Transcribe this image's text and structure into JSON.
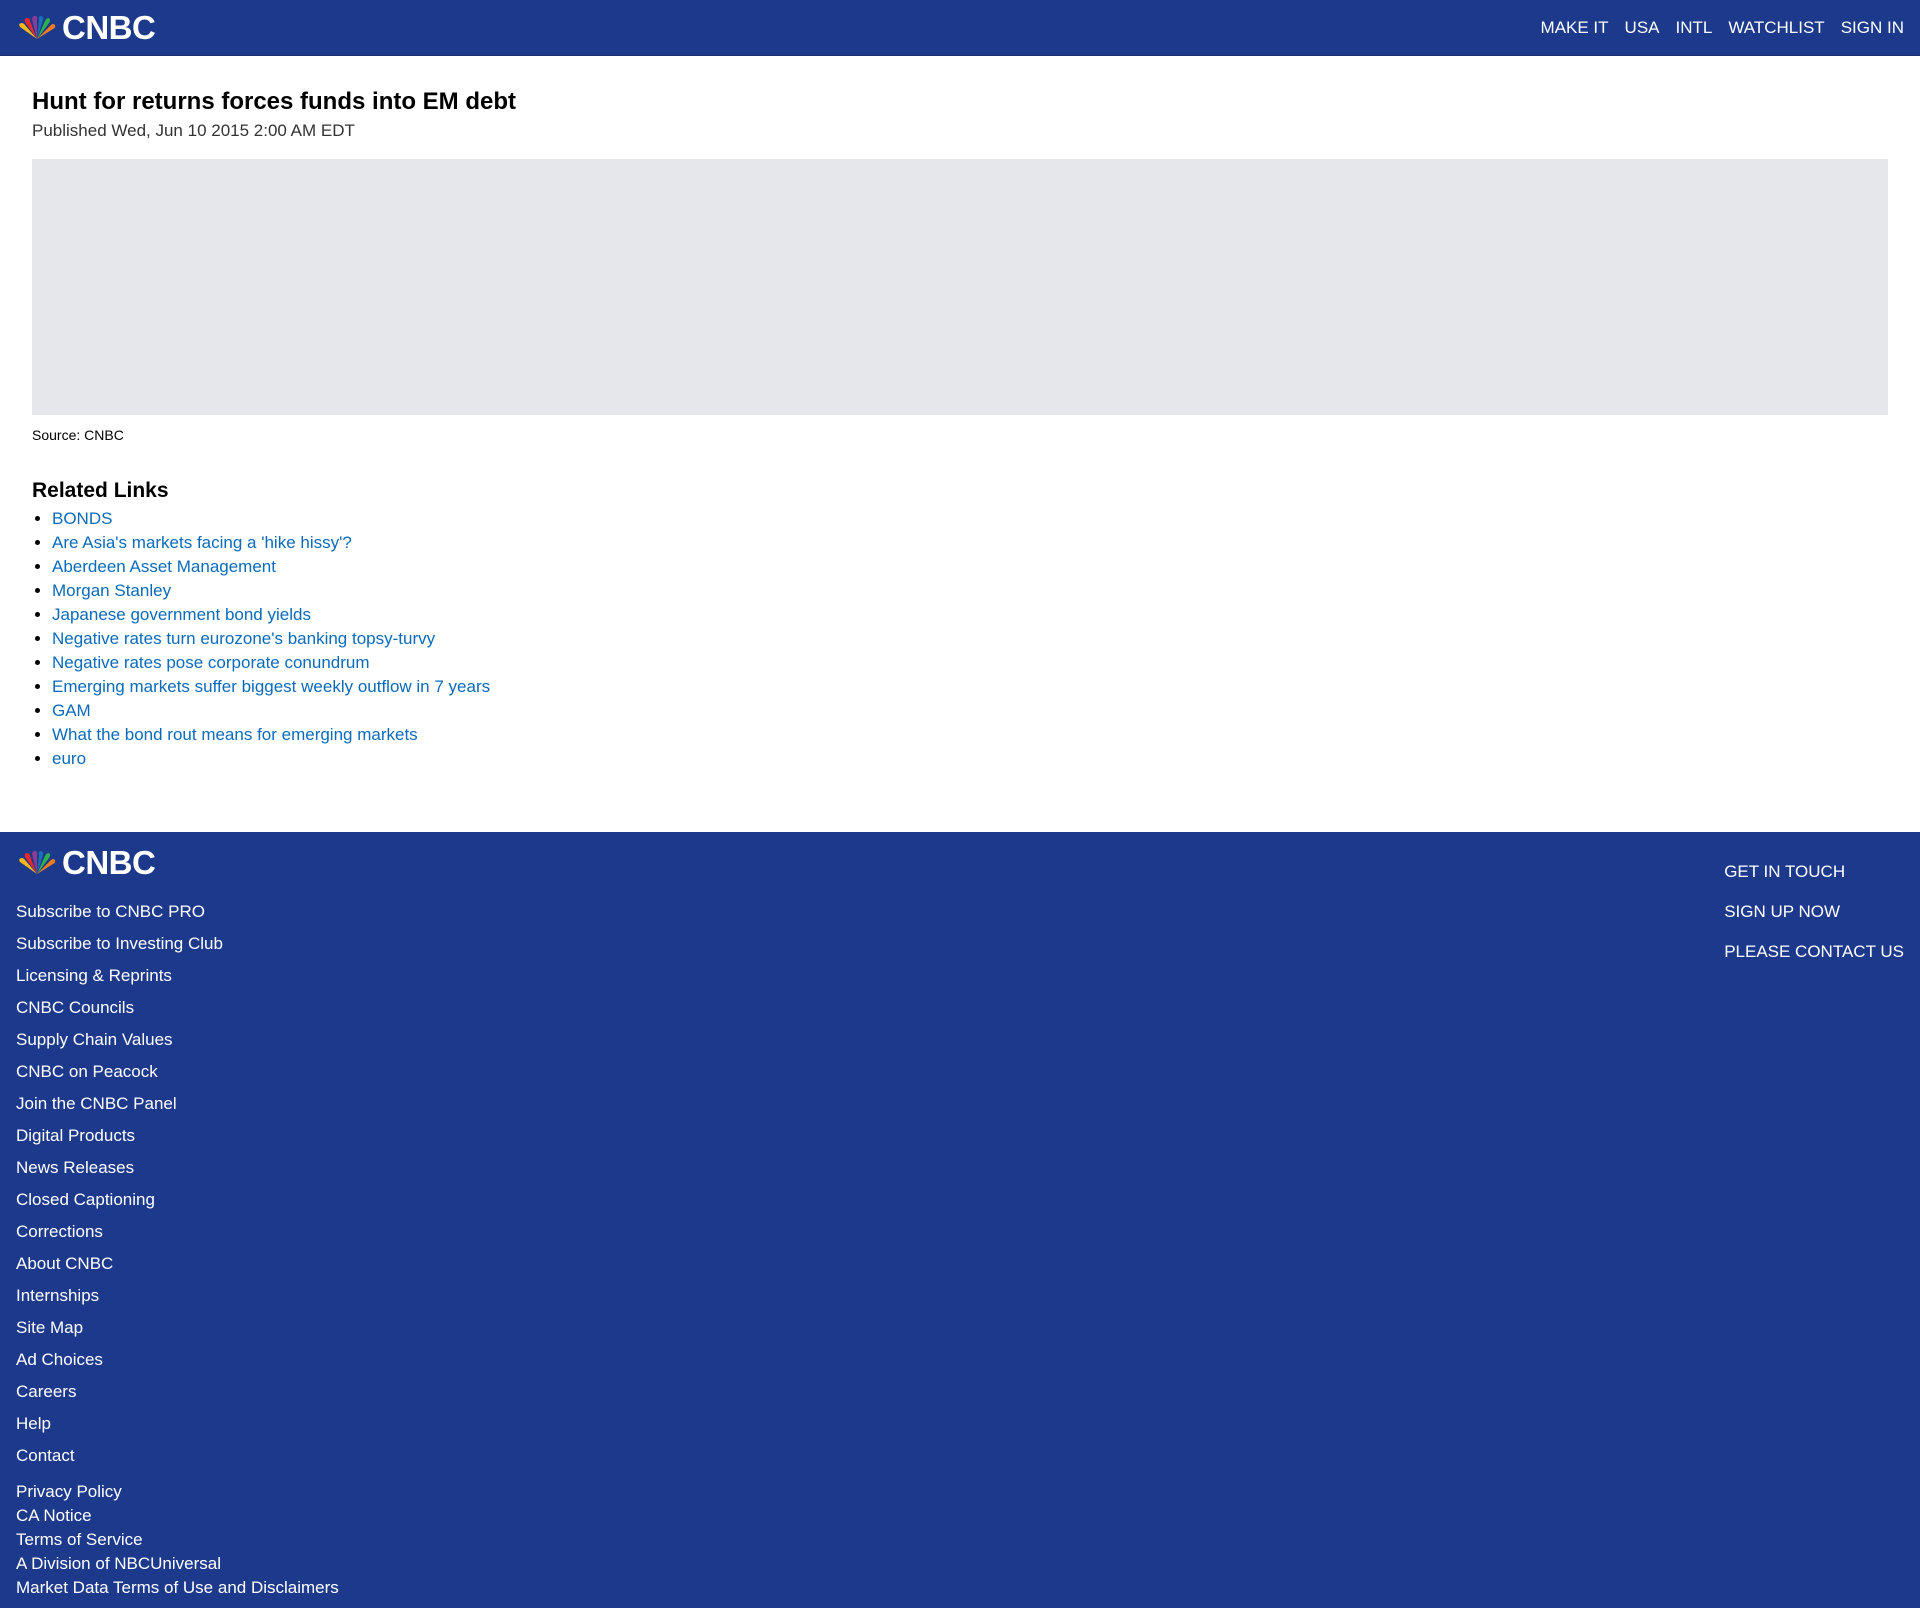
{
  "header": {
    "logo_text": "CNBC",
    "nav": [
      "MAKE IT",
      "USA",
      "INTL",
      "WATCHLIST",
      "SIGN IN"
    ]
  },
  "article": {
    "headline": "Hunt for returns forces funds into EM debt",
    "published": "Published Wed, Jun 10 2015 2:00 AM EDT",
    "caption": "Source: CNBC"
  },
  "related": {
    "title": "Related Links",
    "links": [
      "BONDS",
      "Are Asia's markets facing a 'hike hissy'?",
      "Aberdeen Asset Management",
      "Morgan Stanley",
      "Japanese government bond yields",
      "Negative rates turn eurozone's banking topsy-turvy",
      "Negative rates pose corporate conundrum",
      "Emerging markets suffer biggest weekly outflow in 7 years",
      "GAM",
      "What the bond rout means for emerging markets",
      "euro"
    ]
  },
  "footer": {
    "logo_text": "CNBC",
    "links": [
      "Subscribe to CNBC PRO",
      "Subscribe to Investing Club",
      "Licensing & Reprints",
      "CNBC Councils",
      "Supply Chain Values",
      "CNBC on Peacock",
      "Join the CNBC Panel",
      "Digital Products",
      "News Releases",
      "Closed Captioning",
      "Corrections",
      "About CNBC",
      "Internships",
      "Site Map",
      "Ad Choices",
      "Careers",
      "Help",
      "Contact"
    ],
    "legal": [
      "Privacy Policy",
      "CA Notice",
      "Terms of Service",
      "A Division of NBCUniversal",
      "Market Data Terms of Use and Disclaimers"
    ],
    "right_links": [
      "GET IN TOUCH",
      "SIGN UP NOW",
      "PLEASE CONTACT US"
    ]
  },
  "colors": {
    "brand_blue": "#1d398c",
    "link_blue": "#0a6aba",
    "placeholder_gray": "#e6e7eb"
  }
}
